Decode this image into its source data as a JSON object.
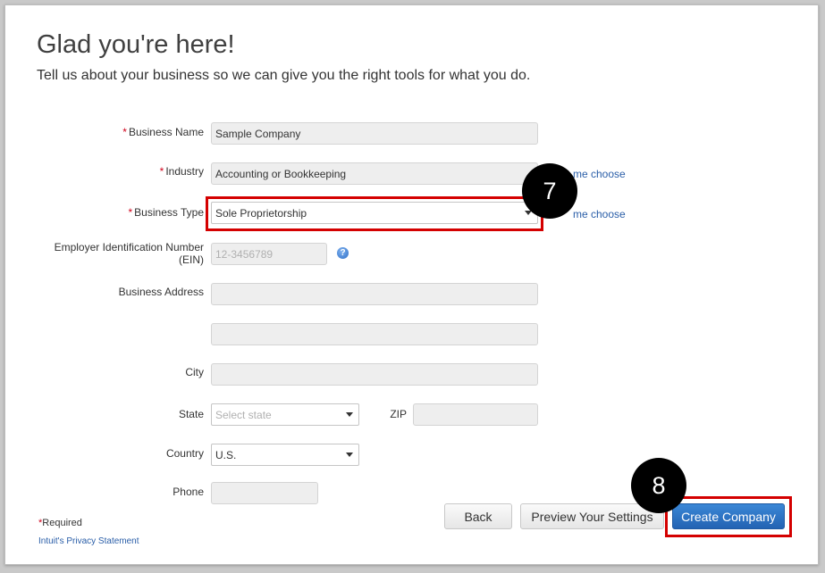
{
  "header": {
    "title": "Glad you're here!",
    "subtitle": "Tell us about your business so we can give you the right tools for what you do."
  },
  "form": {
    "required_mark": "*",
    "business_name": {
      "label": "Business Name",
      "value": "Sample Company"
    },
    "industry": {
      "label": "Industry",
      "value": "Accounting or Bookkeeping",
      "help_link": "me choose"
    },
    "business_type": {
      "label": "Business Type",
      "value": "Sole Proprietorship",
      "help_link": "me choose"
    },
    "ein": {
      "label_line1": "Employer Identification Number",
      "label_line2": "(EIN)",
      "placeholder": "12-3456789",
      "help_icon": "?"
    },
    "address": {
      "label": "Business Address",
      "line1": "",
      "line2": ""
    },
    "city": {
      "label": "City",
      "value": ""
    },
    "state": {
      "label": "State",
      "placeholder": "Select state"
    },
    "zip": {
      "label": "ZIP",
      "value": ""
    },
    "country": {
      "label": "Country",
      "value": "U.S."
    },
    "phone": {
      "label": "Phone",
      "value": ""
    }
  },
  "footer": {
    "required_note": "Required",
    "privacy_link": "Intuit's Privacy Statement"
  },
  "buttons": {
    "back": "Back",
    "preview": "Preview Your Settings",
    "create": "Create Company"
  },
  "annotations": {
    "step7": "7",
    "step8": "8"
  },
  "colors": {
    "highlight": "#d40000",
    "primary_button": "#2a6fc4",
    "link": "#2a5ea8",
    "required": "#d0021b"
  }
}
